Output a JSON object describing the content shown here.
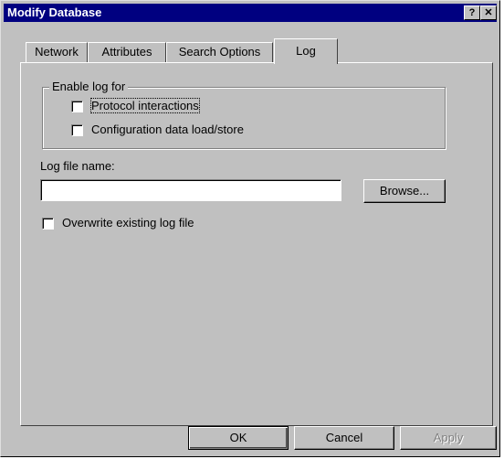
{
  "window": {
    "title": "Modify Database",
    "help_button": "?",
    "close_button": "✕"
  },
  "tabs": [
    {
      "label": "Network",
      "active": false
    },
    {
      "label": "Attributes",
      "active": false
    },
    {
      "label": "Search Options",
      "active": false
    },
    {
      "label": "Log",
      "active": true
    }
  ],
  "log_panel": {
    "group_label": "Enable log for",
    "options": [
      {
        "label": "Protocol interactions",
        "checked": false
      },
      {
        "label": "Configuration data load/store",
        "checked": false
      }
    ],
    "file_label": "Log file name:",
    "file_value": "",
    "browse_label": "Browse...",
    "overwrite_label": "Overwrite existing log file",
    "overwrite_checked": false
  },
  "buttons": {
    "ok": "OK",
    "cancel": "Cancel",
    "apply": "Apply"
  },
  "colors": {
    "title_bar": "#000080",
    "face": "#c0c0c0"
  }
}
